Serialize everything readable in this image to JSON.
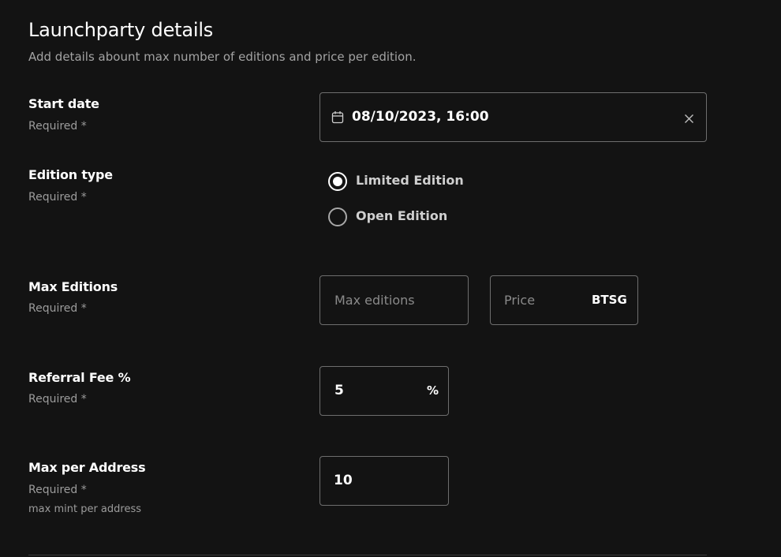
{
  "header": {
    "title": "Launchparty details",
    "subtitle": "Add details abount max number of editions and price per edition."
  },
  "required_text": "Required *",
  "start_date": {
    "label": "Start date",
    "required": "Required *",
    "value": "08/10/2023, 16:00",
    "calendar_icon": "calendar-icon",
    "clear_icon": "close-icon"
  },
  "edition_type": {
    "label": "Edition type",
    "required": "Required *",
    "options": [
      {
        "label": "Limited Edition",
        "selected": true
      },
      {
        "label": "Open Edition",
        "selected": false
      }
    ]
  },
  "max_editions": {
    "label": "Max Editions",
    "required": "Required *",
    "editions_placeholder": "Max editions",
    "price_placeholder": "Price",
    "price_currency": "BTSG"
  },
  "referral_fee": {
    "label": "Referral Fee %",
    "required": "Required *",
    "value": "5",
    "suffix": "%"
  },
  "max_per_address": {
    "label": "Max per Address",
    "required": "Required *",
    "hint": "max mint per address",
    "value": "10"
  }
}
